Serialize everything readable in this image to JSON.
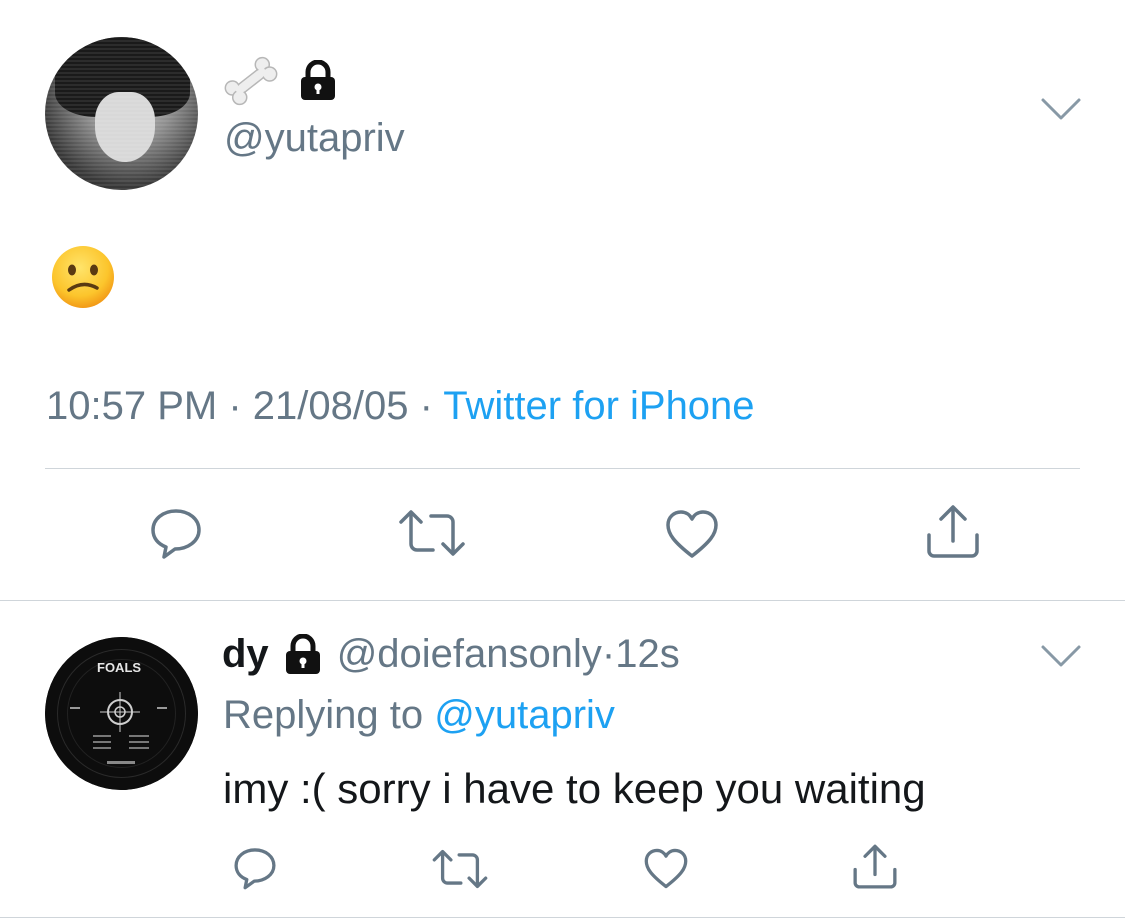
{
  "tweet": {
    "display_name_emojis": [
      "bone-icon",
      "lock-icon"
    ],
    "handle": "@yutapriv",
    "content_emoji": "confused-face",
    "time": "10:57 PM",
    "sep1": " · ",
    "date": "21/08/05",
    "sep2": " · ",
    "source": "Twitter for iPhone",
    "actions": [
      "reply-icon",
      "retweet-icon",
      "like-icon",
      "share-icon"
    ]
  },
  "reply": {
    "name": "dy",
    "handle": "@doiefansonly",
    "separator": " · ",
    "time": "12s",
    "replying_prefix": "Replying to ",
    "replying_to": "@yutapriv",
    "text": "imy :( sorry i have to keep you waiting",
    "avatar_label": "FOALS",
    "actions": [
      "reply-icon",
      "retweet-icon",
      "like-icon",
      "share-icon"
    ]
  },
  "colors": {
    "text": "#14171a",
    "secondary": "#657786",
    "accent": "#1da1f2",
    "divider": "#cfd5da"
  }
}
